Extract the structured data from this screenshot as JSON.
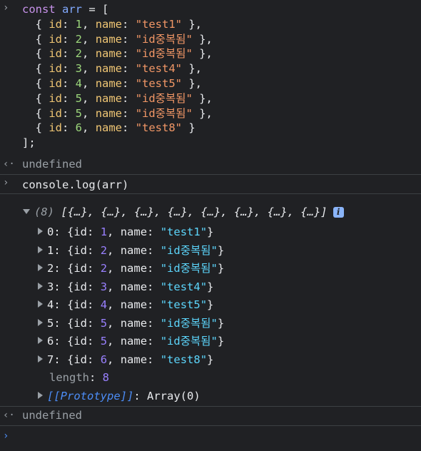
{
  "input1": {
    "lines": [
      [
        {
          "t": "const ",
          "c": "kw"
        },
        {
          "t": "arr",
          "c": "ident"
        },
        {
          "t": " = [",
          "c": "punc"
        }
      ],
      [
        {
          "t": "  { ",
          "c": "punc"
        },
        {
          "t": "id",
          "c": "prop"
        },
        {
          "t": ": ",
          "c": "punc"
        },
        {
          "t": "1",
          "c": "num"
        },
        {
          "t": ", ",
          "c": "punc"
        },
        {
          "t": "name",
          "c": "prop"
        },
        {
          "t": ": ",
          "c": "punc"
        },
        {
          "t": "\"test1\"",
          "c": "str"
        },
        {
          "t": " },",
          "c": "punc"
        }
      ],
      [
        {
          "t": "  { ",
          "c": "punc"
        },
        {
          "t": "id",
          "c": "prop"
        },
        {
          "t": ": ",
          "c": "punc"
        },
        {
          "t": "2",
          "c": "num"
        },
        {
          "t": ", ",
          "c": "punc"
        },
        {
          "t": "name",
          "c": "prop"
        },
        {
          "t": ": ",
          "c": "punc"
        },
        {
          "t": "\"id중복됨\"",
          "c": "str"
        },
        {
          "t": " },",
          "c": "punc"
        }
      ],
      [
        {
          "t": "  { ",
          "c": "punc"
        },
        {
          "t": "id",
          "c": "prop"
        },
        {
          "t": ": ",
          "c": "punc"
        },
        {
          "t": "2",
          "c": "num"
        },
        {
          "t": ", ",
          "c": "punc"
        },
        {
          "t": "name",
          "c": "prop"
        },
        {
          "t": ": ",
          "c": "punc"
        },
        {
          "t": "\"id중복됨\"",
          "c": "str"
        },
        {
          "t": " },",
          "c": "punc"
        }
      ],
      [
        {
          "t": "  { ",
          "c": "punc"
        },
        {
          "t": "id",
          "c": "prop"
        },
        {
          "t": ": ",
          "c": "punc"
        },
        {
          "t": "3",
          "c": "num"
        },
        {
          "t": ", ",
          "c": "punc"
        },
        {
          "t": "name",
          "c": "prop"
        },
        {
          "t": ": ",
          "c": "punc"
        },
        {
          "t": "\"test4\"",
          "c": "str"
        },
        {
          "t": " },",
          "c": "punc"
        }
      ],
      [
        {
          "t": "  { ",
          "c": "punc"
        },
        {
          "t": "id",
          "c": "prop"
        },
        {
          "t": ": ",
          "c": "punc"
        },
        {
          "t": "4",
          "c": "num"
        },
        {
          "t": ", ",
          "c": "punc"
        },
        {
          "t": "name",
          "c": "prop"
        },
        {
          "t": ": ",
          "c": "punc"
        },
        {
          "t": "\"test5\"",
          "c": "str"
        },
        {
          "t": " },",
          "c": "punc"
        }
      ],
      [
        {
          "t": "  { ",
          "c": "punc"
        },
        {
          "t": "id",
          "c": "prop"
        },
        {
          "t": ": ",
          "c": "punc"
        },
        {
          "t": "5",
          "c": "num"
        },
        {
          "t": ", ",
          "c": "punc"
        },
        {
          "t": "name",
          "c": "prop"
        },
        {
          "t": ": ",
          "c": "punc"
        },
        {
          "t": "\"id중복됨\"",
          "c": "str"
        },
        {
          "t": " },",
          "c": "punc"
        }
      ],
      [
        {
          "t": "  { ",
          "c": "punc"
        },
        {
          "t": "id",
          "c": "prop"
        },
        {
          "t": ": ",
          "c": "punc"
        },
        {
          "t": "5",
          "c": "num"
        },
        {
          "t": ", ",
          "c": "punc"
        },
        {
          "t": "name",
          "c": "prop"
        },
        {
          "t": ": ",
          "c": "punc"
        },
        {
          "t": "\"id중복됨\"",
          "c": "str"
        },
        {
          "t": " },",
          "c": "punc"
        }
      ],
      [
        {
          "t": "  { ",
          "c": "punc"
        },
        {
          "t": "id",
          "c": "prop"
        },
        {
          "t": ": ",
          "c": "punc"
        },
        {
          "t": "6",
          "c": "num"
        },
        {
          "t": ", ",
          "c": "punc"
        },
        {
          "t": "name",
          "c": "prop"
        },
        {
          "t": ": ",
          "c": "punc"
        },
        {
          "t": "\"test8\"",
          "c": "str"
        },
        {
          "t": " }",
          "c": "punc"
        }
      ],
      [
        {
          "t": "];",
          "c": "punc"
        }
      ]
    ]
  },
  "result1": {
    "text": "undefined"
  },
  "input2": {
    "object": "console",
    "dot": ".",
    "method": "log",
    "open": "(",
    "arg": "arr",
    "close": ")"
  },
  "log": {
    "count": "(8)",
    "summary": "[{…}, {…}, {…}, {…}, {…}, {…}, {…}, {…}]",
    "info_badge": "i",
    "rows": [
      {
        "index": "0",
        "id": "1",
        "name": "\"test1\""
      },
      {
        "index": "1",
        "id": "2",
        "name": "\"id중복됨\""
      },
      {
        "index": "2",
        "id": "2",
        "name": "\"id중복됨\""
      },
      {
        "index": "3",
        "id": "3",
        "name": "\"test4\""
      },
      {
        "index": "4",
        "id": "4",
        "name": "\"test5\""
      },
      {
        "index": "5",
        "id": "5",
        "name": "\"id중복됨\""
      },
      {
        "index": "6",
        "id": "5",
        "name": "\"id중복됨\""
      },
      {
        "index": "7",
        "id": "6",
        "name": "\"test8\""
      }
    ],
    "length_label": "length",
    "length_value": "8",
    "prototype_label": "[[Prototype]]",
    "prototype_value": "Array(0)"
  },
  "result2": {
    "text": "undefined"
  },
  "icons": {
    "input_chevron": "chevron-right-icon",
    "result_arrow": "return-arrow-icon",
    "prompt_chevron": "prompt-chevron-icon"
  },
  "colors": {
    "background": "#202124",
    "keyword": "#c792ea",
    "identifier": "#82aaff",
    "property": "#f0c674",
    "number": "#9cd67b",
    "string": "#f29766",
    "result_number": "#9980ff",
    "result_string": "#5cd5fb",
    "prompt": "#4c8df6"
  }
}
